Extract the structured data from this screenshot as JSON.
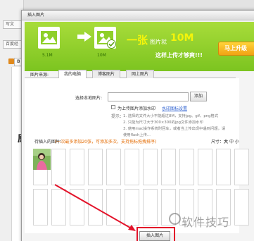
{
  "background": {
    "buttons": [
      "写文",
      "百度经",
      "B"
    ],
    "doc_char": "原"
  },
  "dialog": {
    "title": "插入图片"
  },
  "banner": {
    "size_label_left": "5.1M",
    "size_label_right": "10M",
    "headline_yi": "一张",
    "headline_mid": "图片就",
    "headline_10m": "10M",
    "subline": "这样上传才够爽!!!",
    "button_label": "马上升级"
  },
  "tabs": {
    "source_label": "图片来源:",
    "items": [
      "我的电脑",
      "博客图片",
      "网上图片"
    ],
    "active_index": 0
  },
  "upload": {
    "select_label": "选择本地图片:",
    "path_value": "",
    "add_label": "添加",
    "watermark_checkbox_label": "为上传图片添加水印",
    "watermark_link": "水印图标设置",
    "tips_title": "提示：",
    "tips": [
      "1. 选择的文件大小不能超过8M，支持jpg、gif、png格式",
      "2. 只能为尺寸大于300×300的jpg文件添加水印",
      "3. 使用mac操作系统时回车，或者当上传出现中遇到问题，请",
      "   使用flash上传..."
    ]
  },
  "pending": {
    "label": "待插入的图片：",
    "hint": "(一次最多添加20张，可添加多次，支持拖标拖拽排序)",
    "size_label": "尺寸：",
    "size_large": "大",
    "size_medium": "中",
    "size_small": "小",
    "thumbnail_count": 1
  },
  "actions": {
    "insert_label": "插入图片"
  },
  "watermark": {
    "text": "软件技巧"
  },
  "colors": {
    "banner_green": "#8fd02a",
    "accent_yellow": "#f4f40a",
    "upgrade_orange": "#f1a214",
    "hint_orange": "#e36a00",
    "annotation_red": "#e3132a",
    "link_blue": "#2a5ecf"
  }
}
